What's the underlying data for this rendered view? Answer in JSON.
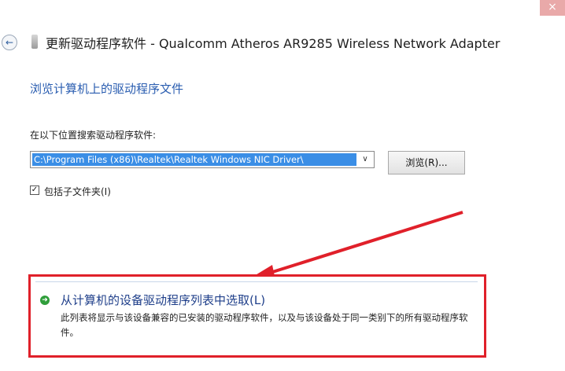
{
  "window": {
    "title": "更新驱动程序软件 - Qualcomm Atheros AR9285 Wireless Network Adapter",
    "close_glyph": "×",
    "back_glyph": "←"
  },
  "page": {
    "heading": "浏览计算机上的驱动程序文件",
    "search_label": "在以下位置搜索驱动程序软件:",
    "path_value": "C:\\Program Files (x86)\\Realtek\\Realtek Windows NIC Driver\\",
    "dropdown_glyph": "∨",
    "browse_label": "浏览(R)...",
    "include_subfolders_label": "包括子文件夹(I)",
    "include_subfolders_checked": true,
    "check_glyph": "✓"
  },
  "option": {
    "title": "从计算机的设备驱动程序列表中选取(L)",
    "description": "此列表将显示与该设备兼容的已安装的驱动程序软件，以及与该设备处于同一类别下的所有驱动程序软件。",
    "arrow_glyph": "➜"
  },
  "colors": {
    "accent_blue": "#2a5db0",
    "highlight_red": "#e0202a",
    "selection_blue": "#3a8ee6"
  },
  "icons": [
    "back-arrow-icon",
    "device-icon",
    "dropdown-arrow-icon",
    "green-arrow-icon",
    "close-icon"
  ]
}
